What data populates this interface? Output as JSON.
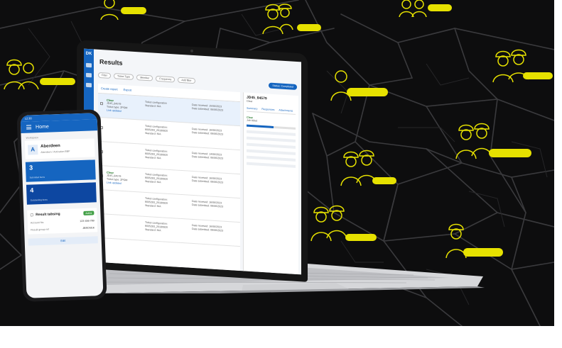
{
  "laptop": {
    "logo": "DK",
    "page_title": "Results",
    "toolbar": {
      "filter": "Filter",
      "ticket_type": "Ticket Type",
      "member": "Member",
      "frequency": "Frequency",
      "more": "Add filter",
      "status_chip": "Status: Completed"
    },
    "list": {
      "create_report": "Create report",
      "export": "Export",
      "rows": [
        {
          "status": "Clear",
          "name": "JD45_84579",
          "type": "Ticket type: ZPDM",
          "link": "Link updated",
          "config": "Ticket configuration",
          "config_line2": "Standard: N/A",
          "meta": "Date received: 15/06/2023",
          "meta2": "Date submitted: 06/06/2023",
          "selected": true
        },
        {
          "status": "",
          "name": "",
          "type": "",
          "link": "",
          "config": "Ticket configuration: 9005293_20180920",
          "config_line2": "Standard: N/A",
          "meta": "Date received: 16/06/2023",
          "meta2": "Date submitted: 09/06/2023",
          "selected": false
        },
        {
          "status": "",
          "name": "",
          "type": "",
          "link": "",
          "config": "Ticket configuration: 9005293_20180920",
          "config_line2": "Standard: N/A",
          "meta": "Date received: 14/06/2023",
          "meta2": "Date submitted: 06/06/2023",
          "selected": false
        },
        {
          "status": "Clear",
          "name": "JD45_84579",
          "type": "Ticket type: ZPDM",
          "link": "Link updated",
          "config": "Ticket configuration: 9005293_20180920",
          "config_line2": "Standard: N/A",
          "meta": "Date received: 16/06/2023",
          "meta2": "Date submitted: 09/06/2023",
          "selected": false
        },
        {
          "status": "",
          "name": "",
          "type": "",
          "link": "",
          "config": "Ticket configuration: 9005293_20180920",
          "config_line2": "Standard: N/A",
          "meta": "Date received: 16/06/2023",
          "meta2": "Date submitted: 09/06/2023",
          "selected": false
        },
        {
          "status": "",
          "name": "",
          "type": "",
          "link": "",
          "config": "Ticket configuration: 9005293_20180920",
          "config_line2": "Standard: N/A",
          "meta": "Date received: 16/06/2023",
          "meta2": "Date submitted: 09/06/2023",
          "selected": false
        }
      ]
    },
    "detail": {
      "title": "JD45_84579",
      "subtitle": "Clear",
      "tabs": [
        "Summary",
        "Responses",
        "Attachments"
      ],
      "status": "Clear",
      "status_sub": "Job ticket"
    }
  },
  "phone": {
    "time": "12:30",
    "header_title": "Home",
    "section_label": "Workspace",
    "area_initial": "A",
    "area_name": "Aberdeen",
    "area_sub": "Aberdeen / Activation BBP",
    "tile1_number": "3",
    "tile1_label": "Submitted items",
    "tile2_number": "4",
    "tile2_label": "Outstanding items",
    "card_title": "Result tabsing",
    "card_badge": "Active",
    "card_rows": [
      {
        "k": "Account No.",
        "v": "123-456-789"
      },
      {
        "k": "Result group ref",
        "v": "JBROVEK"
      }
    ],
    "edit_label": "Edit"
  },
  "colors": {
    "brand_blue": "#1565c0",
    "marker_yellow": "#e6e100",
    "map_bg": "#0d0d0e"
  }
}
